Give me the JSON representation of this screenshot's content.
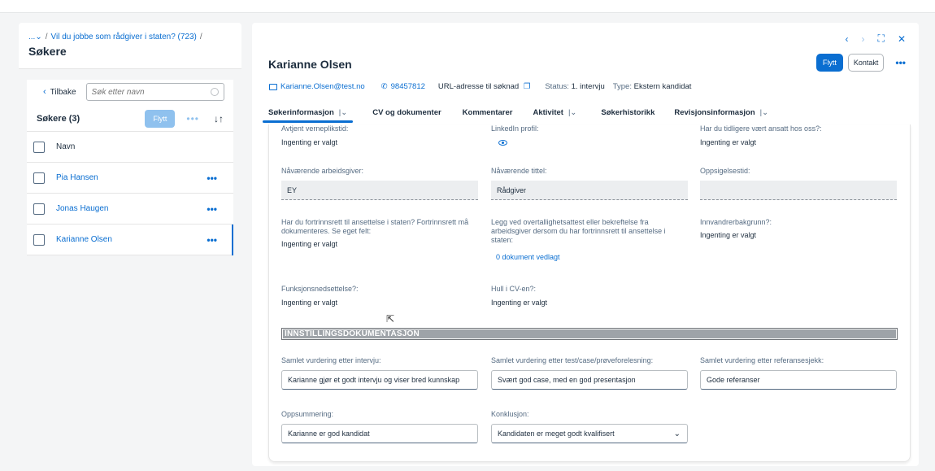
{
  "left_panel": {
    "breadcrumb": {
      "prefix": "...",
      "item": "Vil du jobbe som rådgiver i staten? (723)",
      "sep": "/"
    },
    "title": "Søkere",
    "back_label": "Tilbake",
    "search_placeholder": "Søk etter navn",
    "list_count": "Søkere (3)",
    "move_label": "Flytt",
    "column_header": "Navn",
    "applicants": [
      {
        "name": "Pia Hansen"
      },
      {
        "name": "Jonas Haugen"
      },
      {
        "name": "Karianne Olsen"
      }
    ]
  },
  "detail": {
    "name": "Karianne Olsen",
    "email": "Karianne.Olsen@test.no",
    "phone": "98457812",
    "url_label": "URL-adresse til søknad",
    "status_label": "Status:",
    "status_value": "1. intervju",
    "type_label": "Type:",
    "type_value": "Ekstern kandidat",
    "move_button": "Flytt",
    "contact_button": "Kontakt",
    "tabs": [
      {
        "label": "Søkerinformasjon"
      },
      {
        "label": "CV og dokumenter"
      },
      {
        "label": "Kommentarer"
      },
      {
        "label": "Aktivitet"
      },
      {
        "label": "Søkerhistorikk"
      },
      {
        "label": "Revisjonsinformasjon"
      }
    ],
    "fields": {
      "verneplikt": {
        "label": "Avtjent verneplikstid:",
        "value": "Ingenting er valgt"
      },
      "linkedin": {
        "label": "LinkedIn profil:"
      },
      "tidligere": {
        "label": "Har du tidligere vært ansatt hos oss?:",
        "value": "Ingenting er valgt"
      },
      "arbeidsgiver": {
        "label": "Nåværende arbeidsgiver:",
        "value": "EY"
      },
      "tittel": {
        "label": "Nåværende tittel:",
        "value": "Rådgiver"
      },
      "oppsigelse": {
        "label": "Oppsigelsestid:",
        "value": ""
      },
      "fortrinnsrett": {
        "label": "Har du fortrinnsrett til ansettelse i staten? Fortrinnsrett må dokumenteres. Se eget felt:",
        "value": "Ingenting er valgt"
      },
      "overtallighet": {
        "label": "Legg ved overtallighetsattest eller bekreftelse fra arbeidsgiver dersom du har fortrinnsrett til ansettelse i staten:",
        "value": "0 dokument vedlagt"
      },
      "innvandrer": {
        "label": "Innvandrerbakgrunn?:",
        "value": "Ingenting er valgt"
      },
      "funksjon": {
        "label": "Funksjonsnedsettelse?:",
        "value": "Ingenting er valgt"
      },
      "hull": {
        "label": "Hull i CV-en?:",
        "value": "Ingenting er valgt"
      }
    },
    "section_title": "INNSTILLINGSDOKUMENTASJON",
    "assessment": {
      "intervju": {
        "label": "Samlet vurdering etter intervju:",
        "value": "Karianne gjør et godt intervju og viser bred kunnskap"
      },
      "test": {
        "label": "Samlet vurdering etter test/case/prøveforelesning:",
        "value": "Svært god case, med en god presentasjon"
      },
      "referanse": {
        "label": "Samlet vurdering etter referansesjekk:",
        "value": "Gode referanser"
      },
      "oppsummering": {
        "label": "Oppsummering:",
        "value": "Karianne er god kandidat"
      },
      "konklusjon": {
        "label": "Konklusjon:",
        "value": "Kandidaten er meget godt kvalifisert"
      }
    }
  }
}
